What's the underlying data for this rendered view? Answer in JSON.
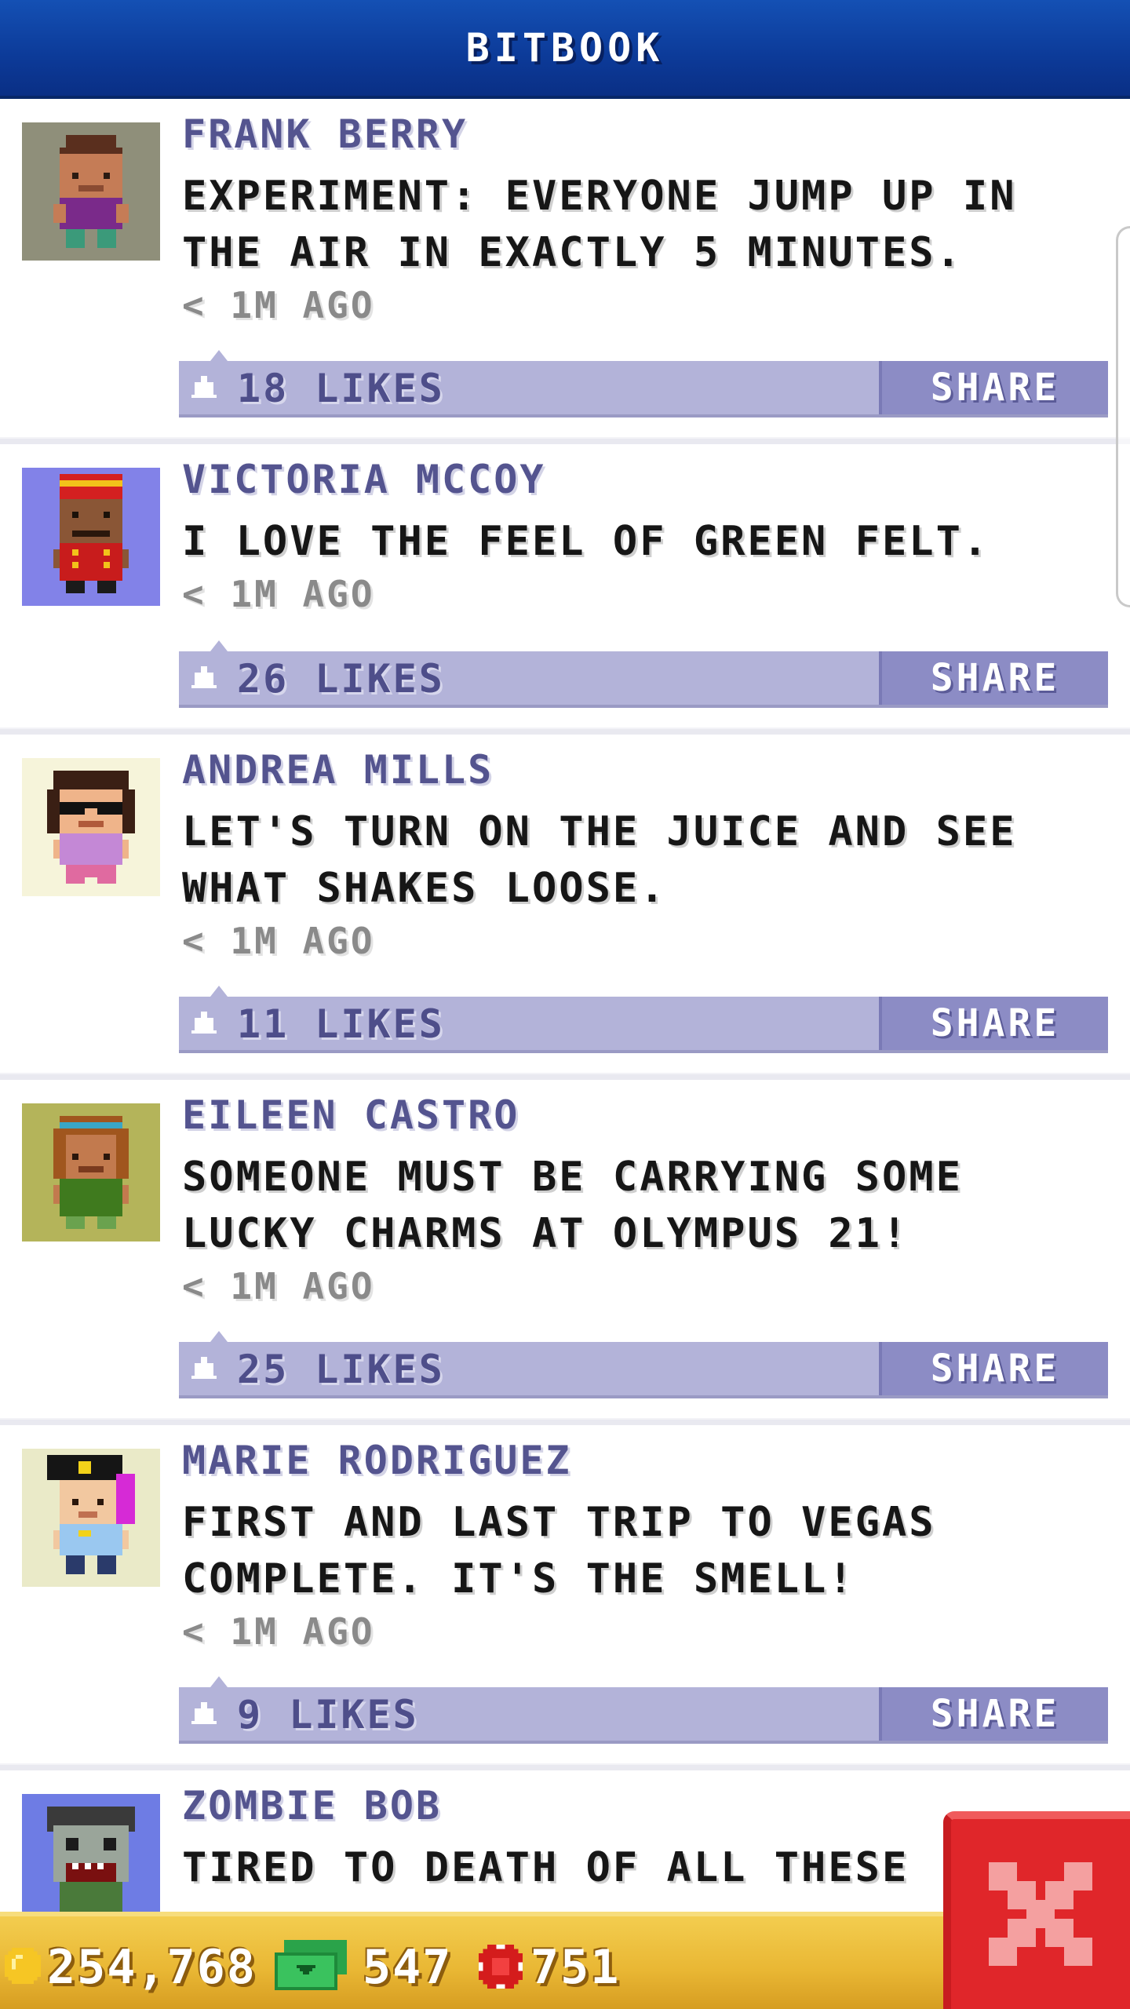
{
  "app": {
    "title": "BITBOOK"
  },
  "posts": [
    {
      "author": "FRANK BERRY",
      "message": "EXPERIMENT: EVERYONE JUMP UP IN THE AIR IN EXACTLY 5 MINUTES.",
      "time": "< 1M AGO",
      "likes": "18 LIKES",
      "share": "SHARE",
      "avatar": "avatar-purple-shirt-boy",
      "avatar_bg": "#8f8f7a"
    },
    {
      "author": "VICTORIA MCCOY",
      "message": "I LOVE THE FEEL OF GREEN FELT.",
      "time": "< 1M AGO",
      "likes": "26 LIKES",
      "share": "SHARE",
      "avatar": "avatar-bellhop",
      "avatar_bg": "#8282e8"
    },
    {
      "author": "ANDREA MILLS",
      "message": "LET'S TURN ON THE JUICE AND SEE WHAT SHAKES LOOSE.",
      "time": "< 1M AGO",
      "likes": "11 LIKES",
      "share": "SHARE",
      "avatar": "avatar-sunglasses-girl",
      "avatar_bg": "#f6f4da"
    },
    {
      "author": "EILEEN CASTRO",
      "message": "SOMEONE MUST BE CARRYING SOME LUCKY CHARMS AT OLYMPUS 21!",
      "time": "< 1M AGO",
      "likes": "25 LIKES",
      "share": "SHARE",
      "avatar": "avatar-green-dress-girl",
      "avatar_bg": "#b4b45a"
    },
    {
      "author": "MARIE RODRIGUEZ",
      "message": "FIRST AND LAST TRIP TO VEGAS COMPLETE. IT'S THE SMELL!",
      "time": "< 1M AGO",
      "likes": "9 LIKES",
      "share": "SHARE",
      "avatar": "avatar-police-officer",
      "avatar_bg": "#eaeac8"
    },
    {
      "author": "ZOMBIE BOB",
      "message": "TIRED TO DEATH OF ALL THESE",
      "time": "",
      "likes": "",
      "share": "",
      "avatar": "avatar-zombie",
      "avatar_bg": "#6e7ce4"
    }
  ],
  "status_bar": {
    "coins": "254,768",
    "coin_icon": "gold-coin-icon",
    "bux": "547",
    "bux_icon": "bux-cash-icon",
    "chips": "751",
    "chip_icon": "casino-chip-icon"
  },
  "close": {
    "icon": "close-icon"
  },
  "colors": {
    "header": "#0c3a98",
    "author": "#54548f",
    "like_bar": "#b3b3d9",
    "share_button": "#8c8cc5",
    "close_button": "#e0262a",
    "bottom_bar": "#e9b734"
  }
}
